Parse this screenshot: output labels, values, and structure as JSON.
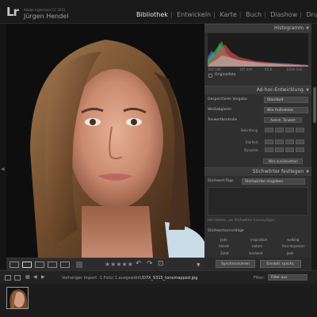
{
  "app": {
    "logo": "Lr",
    "product": "Adobe Lightroom CC 2015",
    "user": "Jürgen Hendel"
  },
  "modules": [
    "Bibliothek",
    "Entwickeln",
    "Karte",
    "Buch",
    "Diashow",
    "Drucken"
  ],
  "active_module": "Bibliothek",
  "panels": {
    "histogram": {
      "title": "Histogramm",
      "labels": [
        "ISO 100",
        "105 mm",
        "f/5,6",
        "1/200 Sek."
      ],
      "original_photo": "Originalfoto"
    },
    "quick_develop": {
      "title": "Ad-hoc-Entwicklung",
      "saved_preset_label": "Gespeicherte Vorgabe",
      "saved_preset_value": "Standard",
      "white_balance_label": "Weißabgleich",
      "white_balance_value": "Wie Aufnahme",
      "tone_control_label": "Tonwertkontrolle",
      "auto_tone_button": "Autom. Tonwert",
      "exposure_label": "Belichtung",
      "clarity_label": "Klarheit",
      "vibrance_label": "Dynamik",
      "reset_button": "Alles zurücksetzen"
    },
    "keywording": {
      "title": "Stichwörter festlegen",
      "tags_label": "Stichwort-Tags",
      "tags_value": "Stichwörter eingeben",
      "add_placeholder": "Hier klicken, um Stichwörter hinzuzufügen",
      "suggestions_label": "Stichwortvorschläge",
      "suggestions": [
        "Jade",
        "inspiration",
        "walking",
        "hänsel",
        "nature",
        "frau-anpassen",
        "Zutat",
        "landwrat",
        "Jade"
      ]
    }
  },
  "sync": {
    "metadata_button": "Synchronisieren",
    "settings_button": "Einstell. synchr."
  },
  "toolbar": {
    "stars": "★★★★★"
  },
  "filmstrip": {
    "source": "Vorheriger Import",
    "count": "1 Foto/ 1 ausgewählt/",
    "filename": "D7X_5315_tonemapped.jpg",
    "filter_label": "Filter:",
    "filter_value": "Filter aus"
  },
  "colors": {
    "panel_bg": "#2f2f2f",
    "header_bg": "#3a3a3a",
    "app_bg": "#1b1b1b",
    "active_text": "#e6e6e6"
  }
}
